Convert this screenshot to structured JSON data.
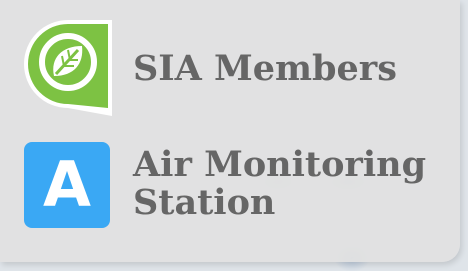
{
  "legend": {
    "items": [
      {
        "icon": "sia-leaf-icon",
        "label": "SIA Members",
        "color": "#7dc243"
      },
      {
        "icon": "air-monitoring-station-icon",
        "letter": "A",
        "label_line1": "Air Monitoring",
        "label_line2": "Station",
        "color": "#3aa8f4"
      }
    ]
  }
}
